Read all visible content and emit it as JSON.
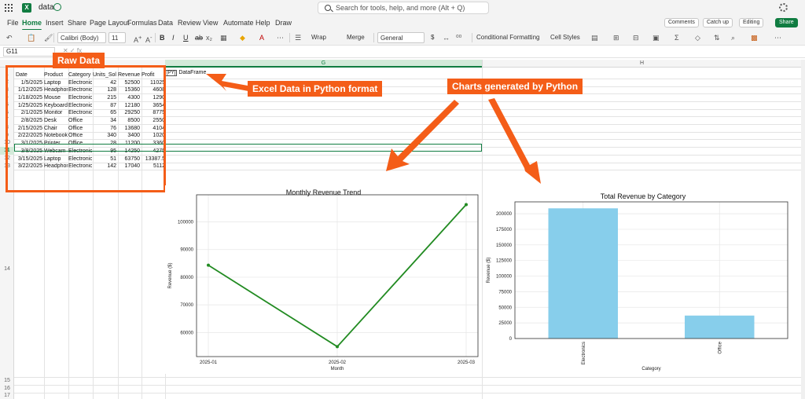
{
  "app": {
    "doc_title": "data",
    "search_placeholder": "Search for tools, help, and more (Alt + Q)"
  },
  "menu": {
    "items": [
      "File",
      "Home",
      "Insert",
      "Share",
      "Page Layout",
      "Formulas",
      "Data",
      "Review",
      "View",
      "Automate",
      "Help",
      "Draw"
    ],
    "active": "Home",
    "comments": "Comments",
    "catch_up": "Catch up",
    "editing": "Editing",
    "share": "Share"
  },
  "ribbon": {
    "font_name": "Calibri (Body)",
    "font_size": "11",
    "wrap": "Wrap",
    "merge": "Merge",
    "number_format": "General",
    "currency": "$",
    "conditional_formatting": "Conditional Formatting",
    "cell_styles": "Cell Styles"
  },
  "formula_bar": {
    "name_box": "G11"
  },
  "grid": {
    "col_g": "G",
    "col_h": "H",
    "row_numbers": [
      "1",
      "2",
      "3",
      "4",
      "5",
      "6",
      "7",
      "8",
      "9",
      "10",
      "11",
      "12",
      "13",
      "14",
      "15",
      "16",
      "17"
    ],
    "selected_row": "11",
    "dataframe_badge": "[PY]",
    "dataframe_text": "DataFrame"
  },
  "table": {
    "headers": [
      "Date",
      "Product",
      "Category",
      "Units_Sold",
      "Revenue",
      "Profit"
    ],
    "header_display": [
      "Date",
      "Product",
      "Category",
      "Units_Solc",
      "Revenue",
      "Profit"
    ],
    "rows": [
      [
        "1/5/2025",
        "Laptop",
        "Electronics",
        "42",
        "52500",
        "11025"
      ],
      [
        "1/12/2025",
        "Headphon",
        "Electronics",
        "128",
        "15360",
        "4608"
      ],
      [
        "1/18/2025",
        "Mouse",
        "Electronics",
        "215",
        "4300",
        "1290"
      ],
      [
        "1/25/2025",
        "Keyboard",
        "Electronics",
        "87",
        "12180",
        "3654"
      ],
      [
        "2/1/2025",
        "Monitor",
        "Electronics",
        "65",
        "29250",
        "8775"
      ],
      [
        "2/8/2025",
        "Desk",
        "Office",
        "34",
        "8500",
        "2550"
      ],
      [
        "2/15/2025",
        "Chair",
        "Office",
        "76",
        "13680",
        "4104"
      ],
      [
        "2/22/2025",
        "Notebook",
        "Office",
        "340",
        "3400",
        "1020"
      ],
      [
        "3/1/2025",
        "Printer",
        "Office",
        "28",
        "11200",
        "3360"
      ],
      [
        "3/8/2025",
        "Webcam",
        "Electronics",
        "95",
        "14250",
        "4275"
      ],
      [
        "3/15/2025",
        "Laptop",
        "Electronics",
        "51",
        "63750",
        "13387.5"
      ],
      [
        "3/22/2025",
        "Headphon",
        "Electronics",
        "142",
        "17040",
        "5112"
      ]
    ]
  },
  "annotations": {
    "raw_data": "Raw Data",
    "excel_python": "Excel Data in Python format",
    "charts_generated": "Charts generated by Python",
    "accent": "#f45d18"
  },
  "chart_data": [
    {
      "type": "line",
      "title": "Monthly Revenue Trend",
      "xlabel": "Month",
      "ylabel": "Revenue ($)",
      "x": [
        "2025-01",
        "2025-02",
        "2025-03"
      ],
      "values": [
        84340,
        54900,
        106240
      ],
      "yticks": [
        60000,
        70000,
        80000,
        90000,
        100000
      ],
      "ylim": [
        51300,
        109800
      ],
      "grid": true,
      "color": "#228b22"
    },
    {
      "type": "bar",
      "title": "Total Revenue by Category",
      "xlabel": "Category",
      "ylabel": "Revenue ($)",
      "categories": [
        "Electronics",
        "Office"
      ],
      "values": [
        208630,
        36780
      ],
      "yticks": [
        0,
        25000,
        50000,
        75000,
        100000,
        125000,
        150000,
        175000,
        200000
      ],
      "ylim": [
        0,
        219000
      ],
      "grid": true,
      "color": "#87ceeb"
    }
  ]
}
